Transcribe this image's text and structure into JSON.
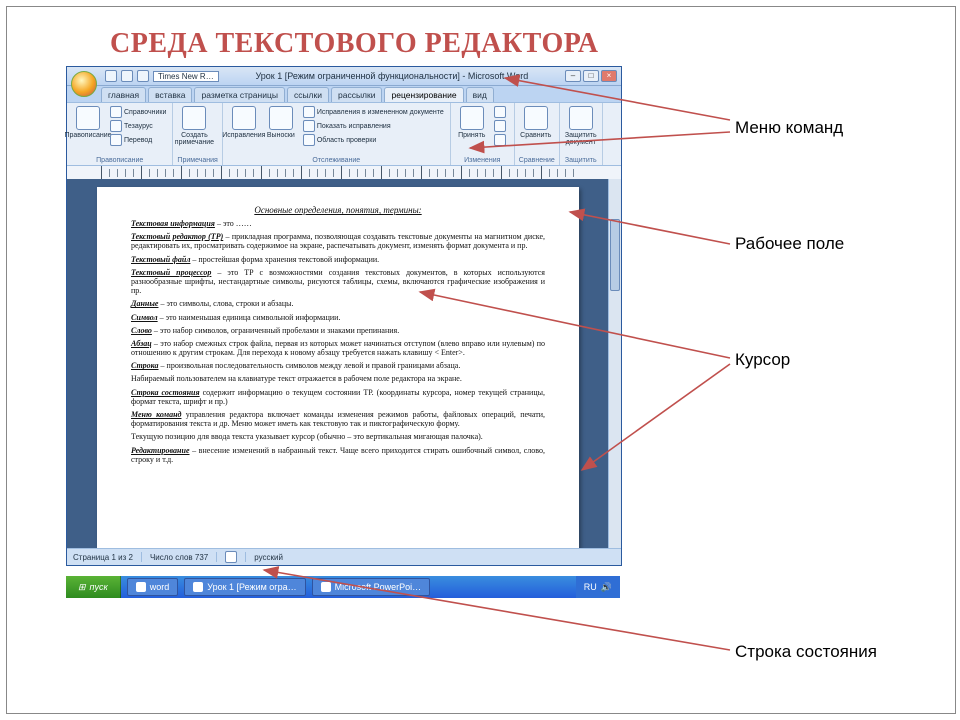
{
  "title": "СРЕДА ТЕКСТОВОГО РЕДАКТОРА",
  "window_title": "Урок 1 [Режим ограниченной функциональности] - Microsoft Word",
  "qat_font": "Times New R…",
  "tabs": [
    "главная",
    "вставка",
    "разметка страницы",
    "ссылки",
    "рассылки",
    "рецензирование",
    "вид"
  ],
  "active_tab": 5,
  "ribbon_groups": [
    {
      "name": "Правописание",
      "large": [
        {
          "name": "abc-icon",
          "label": "Правописание"
        }
      ],
      "small": [
        {
          "icon": "book-icon",
          "label": "Справочники"
        },
        {
          "icon": "book-icon",
          "label": "Тезаурус"
        },
        {
          "icon": "globe-icon",
          "label": "Перевод"
        }
      ]
    },
    {
      "name": "Примечания",
      "large": [
        {
          "name": "comment-icon",
          "label": "Создать примечание"
        }
      ],
      "small": []
    },
    {
      "name": "Отслеживание",
      "large": [
        {
          "name": "track-icon",
          "label": "Исправления"
        },
        {
          "name": "balloon-icon",
          "label": "Выноски"
        }
      ],
      "small": [
        {
          "icon": "doc-icon",
          "label": "Исправления в измененном документе"
        },
        {
          "icon": "doc-icon",
          "label": "Показать исправления"
        },
        {
          "icon": "pane-icon",
          "label": "Область проверки"
        }
      ]
    },
    {
      "name": "Изменения",
      "large": [
        {
          "name": "accept-icon",
          "label": "Принять"
        }
      ],
      "small": [
        {
          "icon": "reject-icon",
          "label": ""
        },
        {
          "icon": "prev-icon",
          "label": ""
        },
        {
          "icon": "next-icon",
          "label": ""
        }
      ]
    },
    {
      "name": "Сравнение",
      "large": [
        {
          "name": "compare-icon",
          "label": "Сравнить"
        }
      ],
      "small": []
    },
    {
      "name": "Защитить",
      "large": [
        {
          "name": "lock-icon",
          "label": "Защитить документ"
        }
      ],
      "small": []
    }
  ],
  "doc": {
    "heading": "Основные определения, понятия, термины:",
    "paragraphs": [
      {
        "term": "Текстовая информация",
        "text": " – это ……"
      },
      {
        "term": "Текстовый редактор (ТР)",
        "text": " – прикладная программа, позволяющая создавать текстовые документы на магнитном диске, редактировать их, просматривать содержимое на экране, распечатывать документ, изменять формат документа и пр."
      },
      {
        "term": "Текстовый файл",
        "text": " – простейшая форма хранения текстовой информации."
      },
      {
        "term": "Текстовый процессор",
        "text": " – это ТР с возможностями создания текстовых документов, в которых используются разнообразные шрифты, нестандартные символы, рисуются таблицы, схемы, включаются графические изображения и пр."
      },
      {
        "term": "Данные",
        "text": " – это символы, слова, строки и абзацы."
      },
      {
        "term": "Символ",
        "text": " – это наименьшая единица символьной информации."
      },
      {
        "term": "Слово",
        "text": " – это набор символов, ограниченный пробелами и знаками препинания."
      },
      {
        "term": "Абзац",
        "text": " – это набор смежных строк файла, первая из которых может начинаться отступом (влево вправо или нулевым) по отношению к другим строкам. Для перехода к новому абзацу требуется нажать клавишу < Enter>."
      },
      {
        "term": "Строка",
        "text": " – произвольная последовательность символов между левой и правой границами абзаца."
      },
      {
        "term": "",
        "text": "Набираемый пользователем на клавиатуре текст отражается в рабочем поле редактора на экране."
      },
      {
        "term": "Строка состояния",
        "text": " содержит информацию о текущем состоянии ТР. (координаты курсора, номер текущей страницы, формат текста, шрифт и пр.)"
      },
      {
        "term": "Меню команд",
        "text": " управления редактора включает команды изменения режимов работы, файловых операций, печати, форматирования текста и др. Меню может иметь как текстовую так и пиктографическую форму."
      },
      {
        "term": "",
        "text": "Текущую позицию для ввода текста указывает курсор (обычно – это вертикальная мигающая палочка)."
      },
      {
        "term": "Редактирование",
        "text": " – внесение изменений в набранный текст. Чаще всего приходится стирать ошибочный символ, слово, строку и т.д."
      }
    ]
  },
  "status": {
    "page": "Страница 1 из 2",
    "words": "Число слов 737",
    "lang": "русский"
  },
  "taskbar": {
    "start": "пуск",
    "tasks": [
      "word",
      "Урок 1 [Режим огра…",
      "Microsoft PowerPoi…"
    ],
    "lang": "RU"
  },
  "callouts": {
    "menu": "Меню команд",
    "field": "Рабочее поле",
    "cursor": "Курсор",
    "status": "Строка состояния"
  }
}
